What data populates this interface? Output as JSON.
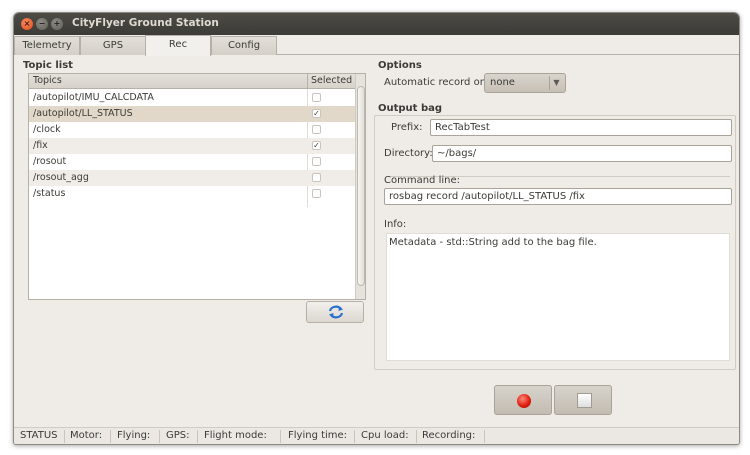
{
  "window": {
    "title": "CityFlyer Ground Station",
    "close_glyph": "×",
    "min_glyph": "−",
    "max_glyph": "+"
  },
  "tabs": [
    {
      "label": "Telemetry"
    },
    {
      "label": "GPS"
    },
    {
      "label": "Rec",
      "active": true
    },
    {
      "label": "Config"
    }
  ],
  "topic_list": {
    "title": "Topic list",
    "col_topics": "Topics",
    "col_selected": "Selected",
    "rows": [
      {
        "topic": "/autopilot/IMU_CALCDATA",
        "checked": ""
      },
      {
        "topic": "/autopilot/LL_STATUS",
        "checked": "✓"
      },
      {
        "topic": "/clock",
        "checked": ""
      },
      {
        "topic": "/fix",
        "checked": "✓"
      },
      {
        "topic": "/rosout",
        "checked": ""
      },
      {
        "topic": "/rosout_agg",
        "checked": ""
      },
      {
        "topic": "/status",
        "checked": ""
      }
    ],
    "refresh_icon": "refresh-icon"
  },
  "options": {
    "title": "Options",
    "auto_record_label": "Automatic record on:",
    "auto_record_value": "none",
    "dropdown_glyph": "▼"
  },
  "output_bag": {
    "title": "Output bag",
    "prefix_label": "Prefix:",
    "prefix_value": "RecTabTest",
    "directory_label": "Directory:",
    "directory_value": "~/bags/",
    "command_label": "Command line:",
    "command_value": "rosbag record /autopilot/LL_STATUS /fix",
    "info_label": "Info:",
    "info_text": "Metadata - std::String add to the bag file."
  },
  "controls": {
    "record_icon": "record-icon",
    "stop_icon": "stop-icon"
  },
  "statusbar": {
    "status": "STATUS",
    "motor": "Motor:",
    "flying": "Flying:",
    "gps": "GPS:",
    "flight_mode": "Flight mode:",
    "flying_time": "Flying time:",
    "cpu_load": "Cpu load:",
    "recording": "Recording:"
  },
  "colors": {
    "accent_record": "#e01f0f",
    "selected_row": "#e2d8c9",
    "titlebar": "#3c3b37"
  }
}
